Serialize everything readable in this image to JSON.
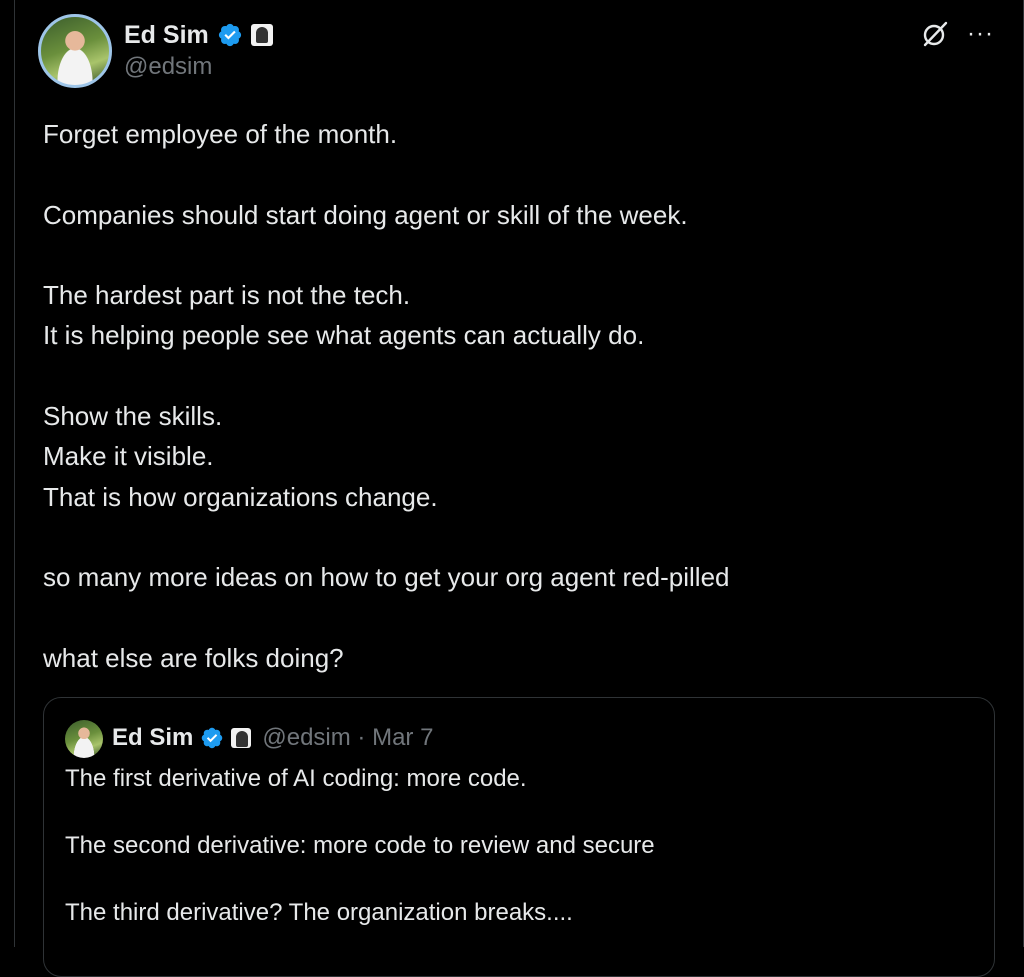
{
  "post": {
    "author_name": "Ed Sim",
    "author_handle": "@edsim",
    "paragraphs": [
      "Forget employee of the month.",
      "",
      "Companies should start doing agent or skill of the week.",
      "",
      "The hardest part is not the tech.",
      "It is helping people see what agents can actually do.",
      "",
      "Show the skills.",
      "Make it visible.",
      "That is how organizations change.",
      "",
      "so many more ideas on how to get your org agent red-pilled",
      "",
      "what else are folks doing?"
    ]
  },
  "icons": {
    "verified": "verified-badge-icon",
    "affiliate": "affiliate-badge-icon",
    "grok": "grok-icon",
    "more": "more-options-icon"
  },
  "more_glyph": "···",
  "quote": {
    "author_name": "Ed Sim",
    "meta": "@edsim · Mar 7",
    "lines": [
      "The first derivative of AI coding: more code.",
      "",
      "The second derivative: more code to review and secure",
      "",
      "The third derivative? The organization breaks...."
    ]
  },
  "colors": {
    "background": "#000000",
    "text": "#e7e9ea",
    "secondary_text": "#71767b",
    "verified_blue": "#1d9bf0",
    "border": "#2f3336"
  }
}
